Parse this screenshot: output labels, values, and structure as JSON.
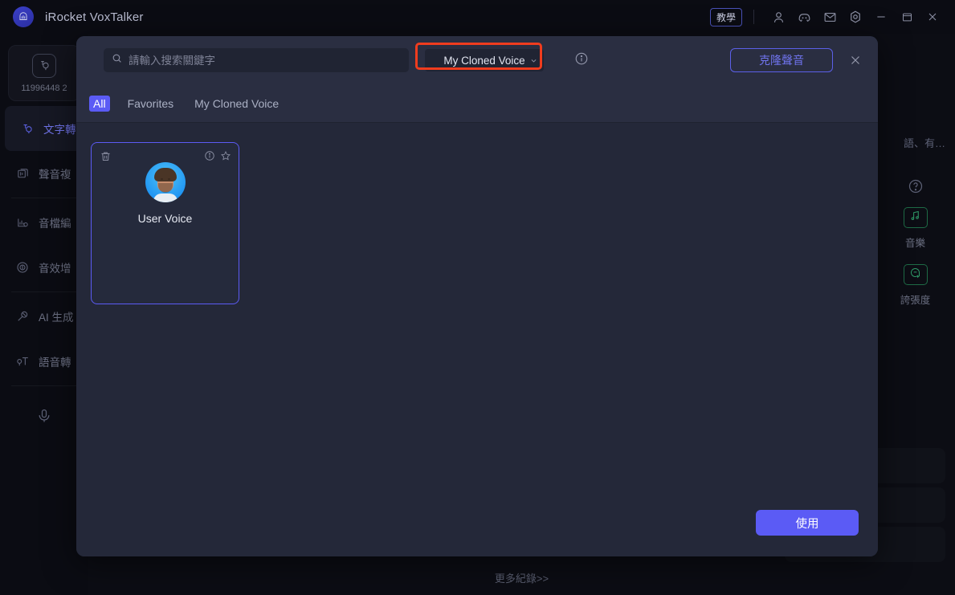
{
  "titlebar": {
    "app_title": "iRocket VoxTalker",
    "tutorial_badge": "教學",
    "icons": [
      "user-icon",
      "discord-icon",
      "mail-icon",
      "settings-icon",
      "minimize-icon",
      "maximize-icon",
      "close-icon"
    ]
  },
  "sidebar": {
    "account_id": "11996448  2",
    "items": [
      {
        "label": "文字轉",
        "icon": "text-to-speech-icon",
        "active": true
      },
      {
        "label": "聲音複",
        "icon": "voice-clone-icon",
        "active": false
      },
      {
        "label": "音檔編",
        "icon": "audio-edit-icon",
        "active": false
      },
      {
        "label": "音效增",
        "icon": "audio-enhance-icon",
        "active": false
      },
      {
        "label": "AI 生成",
        "icon": "ai-generate-icon",
        "active": false
      },
      {
        "label": "語音轉",
        "icon": "speech-to-text-icon",
        "active": false
      }
    ],
    "bottom_icon": "microphone-icon"
  },
  "background": {
    "text_snippet": "語、有…",
    "help_icon": "help-circle-icon",
    "rails": [
      {
        "label": "音樂",
        "icon": "music-note-icon",
        "color": "#2f9c68"
      },
      {
        "label": "誇張度",
        "icon": "exaggeration-icon",
        "color": "#2f9c68"
      }
    ],
    "rows": [
      "…",
      "…",
      "…"
    ],
    "more_records": "更多紀錄>>"
  },
  "modal": {
    "search": {
      "placeholder": "請輸入搜索關鍵字",
      "value": "",
      "icon": "search-icon"
    },
    "dropdown": {
      "value": "My Cloned Voice",
      "icon": "chevron-down-icon",
      "highlight_color": "#f03c1e"
    },
    "info_icon": "info-circle-icon",
    "clone_button": "克隆聲音",
    "close_icon": "close-icon",
    "tabs": [
      {
        "label": "All",
        "active": true
      },
      {
        "label": "Favorites",
        "active": false
      },
      {
        "label": "My Cloned Voice",
        "active": false
      }
    ],
    "cards": [
      {
        "name": "User Voice",
        "trash_icon": "trash-icon",
        "info_icon": "info-circle-icon",
        "star_icon": "star-icon",
        "avatar": "user-avatar",
        "selected": true
      }
    ],
    "use_button": "使用",
    "accent_color": "#5b5bf5"
  }
}
